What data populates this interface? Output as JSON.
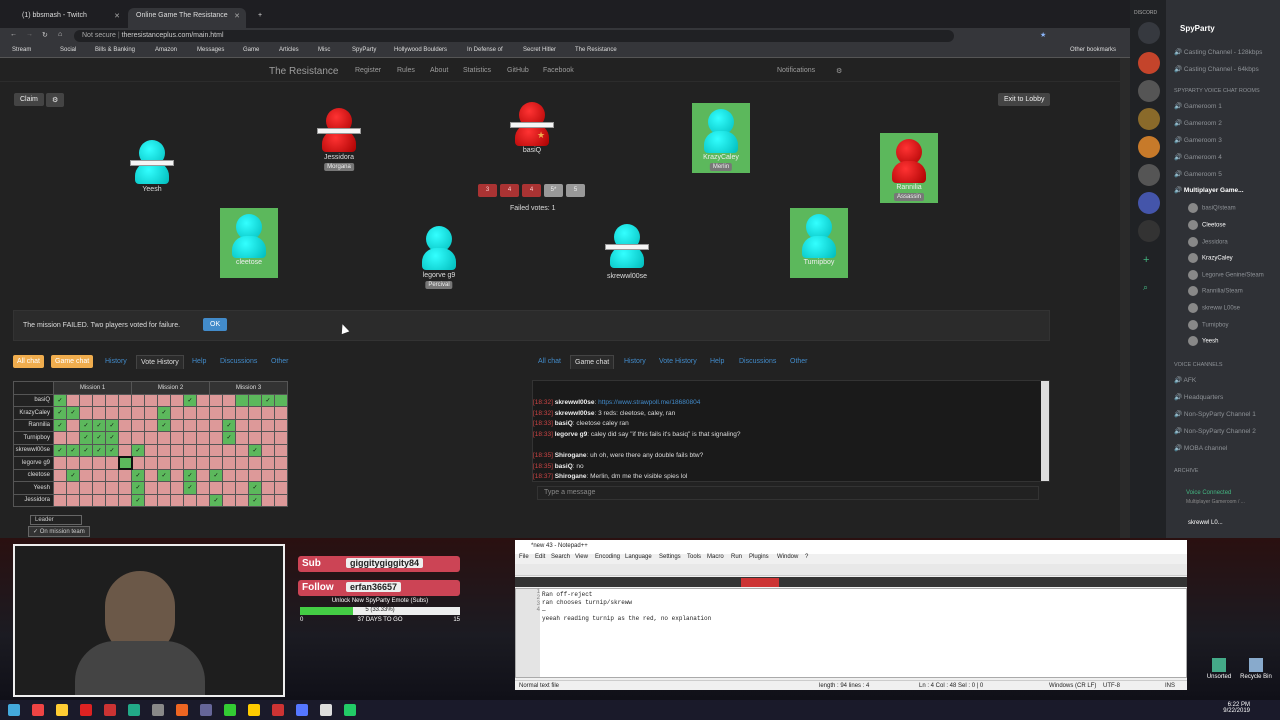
{
  "browser": {
    "tabs": [
      {
        "label": "(1) bbsmash - Twitch"
      },
      {
        "label": "Online Game The Resistance"
      }
    ],
    "url_security": "Not secure",
    "url": "theresistanceplus.com/main.html",
    "bookmarks": [
      "Stream",
      "Social",
      "Bills & Banking",
      "Amazon",
      "Messages",
      "Game",
      "Articles",
      "Misc",
      "SpyParty",
      "Hollywood Boulders",
      "In Defense of",
      "Secret Hitler",
      "The Resistance"
    ],
    "other_bookmarks": "Other bookmarks"
  },
  "site": {
    "brand": "The Resistance",
    "nav": [
      "Register",
      "Rules",
      "About",
      "Statistics",
      "GitHub",
      "Facebook"
    ],
    "notifications": "Notifications",
    "claim_label": "Claim",
    "exit_label": "Exit to Lobby",
    "failed_votes": "Failed votes: 1",
    "mission_boxes": [
      "3",
      "4",
      "4",
      "5*",
      "5"
    ],
    "players": [
      {
        "name": "Yeesh",
        "role": "",
        "color": "cyan",
        "green": false,
        "gun": true
      },
      {
        "name": "Jessidora",
        "role": "Morgana",
        "color": "red",
        "green": false,
        "gun": true
      },
      {
        "name": "basiQ",
        "role": "",
        "color": "red",
        "green": false,
        "gun": true
      },
      {
        "name": "KrazyCaley",
        "role": "Merlin",
        "color": "cyan",
        "green": true,
        "gun": false
      },
      {
        "name": "Rannilia",
        "role": "Assassin",
        "color": "red",
        "green": true,
        "gun": false
      },
      {
        "name": "cleetose",
        "role": "",
        "color": "cyan",
        "green": true,
        "gun": false
      },
      {
        "name": "legorve g9",
        "role": "Percival",
        "color": "cyan",
        "green": false,
        "gun": false
      },
      {
        "name": "skrewwl00se",
        "role": "",
        "color": "cyan",
        "green": false,
        "gun": true
      },
      {
        "name": "Turnipboy",
        "role": "",
        "color": "cyan",
        "green": true,
        "gun": false
      }
    ],
    "message": "The mission FAILED. Two players voted for failure.",
    "ok_label": "OK",
    "left_tabs": [
      "All chat",
      "Game chat",
      "History",
      "Vote History",
      "Help",
      "Discussions",
      "Other"
    ],
    "right_tabs": [
      "All chat",
      "Game chat",
      "History",
      "Vote History",
      "Help",
      "Discussions",
      "Other"
    ],
    "vote_history": {
      "missions": [
        "Mission 1",
        "Mission 2",
        "Mission 3"
      ],
      "rows": [
        "basiQ",
        "KrazyCaley",
        "Rannilia",
        "Turnipboy",
        "skrewwl00se",
        "legorve g9",
        "cleetose",
        "Yeesh",
        "Jessidora"
      ]
    },
    "legend": {
      "leader": "Leader",
      "on_team": "On mission team"
    },
    "chat": [
      {
        "time": "[18:32]",
        "name": "skrewwl00se",
        "text": "https://www.strawpoll.me/18680804",
        "link": true
      },
      {
        "time": "[18:32]",
        "name": "skrewwl00se",
        "text": "3 reds: cleetose, caley, ran",
        "link": false
      },
      {
        "time": "[18:33]",
        "name": "basiQ",
        "text": "cleetose caley ran",
        "link": false
      },
      {
        "time": "[18:33]",
        "name": "legorve g9",
        "text": "caley did say \"if this fails it's basiq\" is that signaling?",
        "link": false
      },
      {
        "time": "[18:35]",
        "name": "Shirogane",
        "text": "uh oh, were there any double fails btw?",
        "link": false
      },
      {
        "time": "[18:35]",
        "name": "basiQ",
        "text": "no",
        "link": false
      },
      {
        "time": "[18:37]",
        "name": "Shirogane",
        "text": "Merlin, dm me the visible spies lol",
        "link": false
      }
    ],
    "chat_placeholder": "Type a message"
  },
  "discord": {
    "header": "DISCORD",
    "server": "SpyParty",
    "channels": [
      "Casting Channel - 128kbps",
      "Casting Channel - 64kbps"
    ],
    "section_voice": "SpyParty Voice Chat Rooms",
    "rooms": [
      "Gameroom 1",
      "Gameroom 2",
      "Gameroom 3",
      "Gameroom 4",
      "Gameroom 5"
    ],
    "active_channel": "Multiplayer Game...",
    "users": [
      "basiQ/steam",
      "Cleetose",
      "Jessidora",
      "KrazyCaley",
      "Legorve Genine/Steam",
      "Rannilia/Steam",
      "skreww L00se",
      "Turnipboy",
      "Yeesh"
    ],
    "section_voice2": "Voice Channels",
    "voice2": [
      "AFK",
      "Headquarters",
      "Non-SpyParty Channel 1",
      "Non-SpyParty Channel 2",
      "MOBA channel"
    ],
    "section_archive": "Archive",
    "voice_status": "Voice Connected",
    "voice_sub": "Multiplayer Gameroom / ...",
    "self_name": "skrewwl L0..."
  },
  "stream": {
    "sub_label": "Sub",
    "sub_name": "giggitygiggity84",
    "follow_label": "Follow",
    "follow_name": "erfan36657",
    "goal_title": "Unlock New SpyParty Emote (Subs)",
    "goal_value": "5 (33.33%)",
    "goal_min": "0",
    "goal_max": "15",
    "goal_days": "37 DAYS TO GO",
    "goal_fraction": 0.3333
  },
  "notepad": {
    "title": "*new 43 - Notepad++",
    "menu": [
      "File",
      "Edit",
      "Search",
      "View",
      "Encoding",
      "Language",
      "Settings",
      "Tools",
      "Macro",
      "Run",
      "Plugins",
      "Window",
      "?"
    ],
    "lines": [
      "Ran off-reject",
      "ran chooses turnip/skreww",
      "—",
      "yeeah reading turnip as the red, no explanation"
    ],
    "status_left": "Normal text file",
    "status_len": "length : 94   lines : 4",
    "status_pos": "Ln : 4   Col : 48   Sel : 0 | 0",
    "status_eol": "Windows (CR LF)",
    "status_enc": "UTF-8",
    "status_ins": "INS"
  },
  "desktop": {
    "icons": [
      "Unsorted",
      "Recycle Bin"
    ]
  },
  "taskbar": {
    "time": "6:22 PM",
    "date": "9/22/2019"
  }
}
